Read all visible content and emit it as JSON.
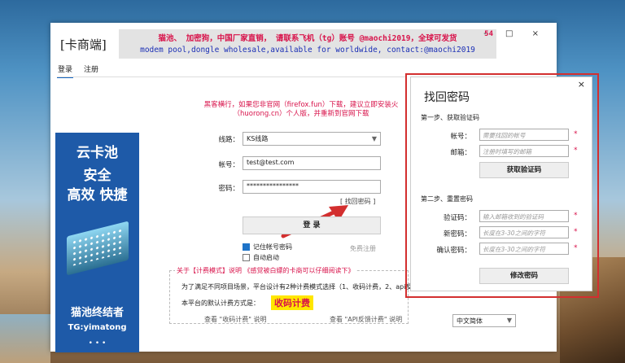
{
  "app": {
    "title": "[卡商端]",
    "window_controls": "- □ ×"
  },
  "banner": {
    "line1": "猫池、 加密狗，中国厂家直销， 请联系飞机（tg）账号 @maochi2019，全球可发货",
    "line2": "modem pool,dongle wholesale,available for worldwide,  contact:@maochi2019",
    "badge": "54"
  },
  "tabs": [
    {
      "label": "登录",
      "active": true
    },
    {
      "label": "注册",
      "active": false
    }
  ],
  "promo": {
    "line1": "云卡池",
    "line2": "安全",
    "line3": "高效 快捷",
    "line4": "猫池终结者",
    "line5": "TG:yimatong",
    "dots": "• • •"
  },
  "notice": {
    "line1": "黑客横行，如果您非官网（firefox.fun）下载，建议立即安装火",
    "line2": "（huorong.cn）个人版，并重新到官网下载"
  },
  "login": {
    "route_label": "线路：",
    "route_value": "KS线路",
    "account_label": "帐号：",
    "account_value": "test@test.com",
    "password_label": "密码：",
    "password_value": "****************",
    "forgot_link": "[ 找回密码 ]",
    "login_button": "登 录",
    "remember_label": "记住帐号密码",
    "remember_checked": true,
    "autostart_label": "自动启动",
    "autostart_checked": false,
    "free_register": "免费注册"
  },
  "billing": {
    "legend": "关于【计费模式】说明 《感觉被白嫖的卡商可以仔细阅读下》",
    "description": "为了满足不同项目场景，平台设计有2种计费模式选择（1、收码计费，2、api反",
    "default_label": "本平台的默认计费方式是：",
    "default_value": "收码计费",
    "link1": "查看 \"收码计费\" 说明",
    "link2": "查看 \"API反馈计费\" 说明"
  },
  "language": {
    "value": "中文简体"
  },
  "recover": {
    "close": "×",
    "title": "找回密码",
    "step1": "第一步、获取验证码",
    "account_label": "帐号：",
    "account_placeholder": "需要找回的帐号",
    "email_label": "邮箱：",
    "email_placeholder": "注册时填写的邮箱",
    "get_code_button": "获取验证码",
    "step2": "第二步、重置密码",
    "code_label": "验证码：",
    "code_placeholder": "输入邮箱收到的验证码",
    "new_pwd_label": "新密码：",
    "new_pwd_placeholder": "长度在3-30之间的字符",
    "confirm_pwd_label": "确认密码：",
    "confirm_pwd_placeholder": "长度在3-30之间的字符",
    "required_mark": "*",
    "modify_button": "修改密码"
  },
  "colors": {
    "accent_red": "#d8124a",
    "highlight_outline": "#d32f2f",
    "promo_blue": "#1e5aa8",
    "highlight_yellow": "#ffe600"
  }
}
